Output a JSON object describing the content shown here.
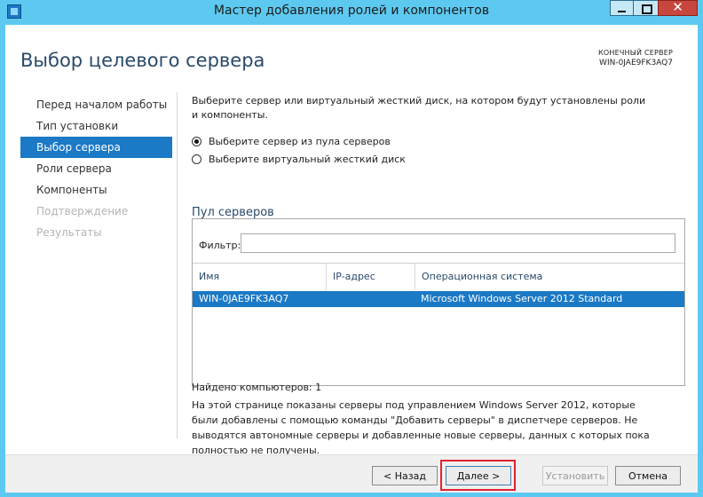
{
  "window": {
    "title": "Мастер добавления ролей и компонентов",
    "min_glyph": "",
    "close_glyph": "✕"
  },
  "page": {
    "title": "Выбор целевого сервера",
    "destination_label": "КОНЕЧНЫЙ СЕРВЕР",
    "destination_value": "WIN-0JAE9FK3AQ7"
  },
  "nav": {
    "items": [
      {
        "label": "Перед началом работы",
        "state": "normal"
      },
      {
        "label": "Тип установки",
        "state": "normal"
      },
      {
        "label": "Выбор сервера",
        "state": "active"
      },
      {
        "label": "Роли сервера",
        "state": "normal"
      },
      {
        "label": "Компоненты",
        "state": "normal"
      },
      {
        "label": "Подтверждение",
        "state": "disabled"
      },
      {
        "label": "Результаты",
        "state": "disabled"
      }
    ]
  },
  "content": {
    "description": "Выберите сервер или виртуальный жесткий диск, на котором будут установлены роли и компоненты.",
    "radio_pool": "Выберите сервер из пула серверов",
    "radio_vhd": "Выберите виртуальный жесткий диск",
    "pool_title": "Пул серверов",
    "filter_label": "Фильтр:",
    "filter_value": "",
    "columns": {
      "name": "Имя",
      "ip": "IP-адрес",
      "os": "Операционная система"
    },
    "rows": [
      {
        "name": "WIN-0JAE9FK3AQ7",
        "ip": "",
        "os": "Microsoft Windows Server 2012 Standard"
      }
    ],
    "found": "Найдено компьютеров: 1",
    "note": "На этой странице показаны серверы под управлением Windows Server 2012, которые были добавлены с помощью команды \"Добавить серверы\" в диспетчере серверов. Не выводятся автономные серверы и добавленные новые серверы, данных с которых пока полностью не получены."
  },
  "footer": {
    "back": "< Назад",
    "next": "Далее >",
    "install": "Установить",
    "cancel": "Отмена"
  },
  "colors": {
    "accent": "#1b79c6",
    "highlight": "#e0232f",
    "title_text": "#2a4a6a"
  }
}
